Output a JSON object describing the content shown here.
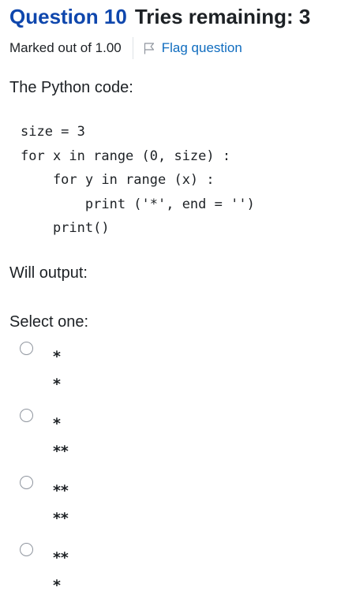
{
  "question": {
    "number_label": "Question 10",
    "tries_label": "Tries remaining: 3",
    "marked_out_of": "Marked out of 1.00",
    "flag_label": "Flag question"
  },
  "content": {
    "prompt": "The Python code:",
    "code_lines": [
      "size = 3",
      "for x in range (0, size) :",
      "    for y in range (x) :",
      "        print ('*', end = '')",
      "    print()"
    ],
    "will_output": "Will output:",
    "select_one": "Select one:"
  },
  "options": [
    {
      "line1": "*",
      "line2": "*"
    },
    {
      "line1": "*",
      "line2": "**"
    },
    {
      "line1": "**",
      "line2": "**"
    },
    {
      "line1": "**",
      "line2": "*"
    }
  ],
  "colors": {
    "question_number": "#0f47ad",
    "link": "#0f6cbf",
    "text": "#1d2125"
  },
  "icons": {
    "flag": "flag-outline-icon",
    "radio": "radio-unchecked-icon"
  }
}
